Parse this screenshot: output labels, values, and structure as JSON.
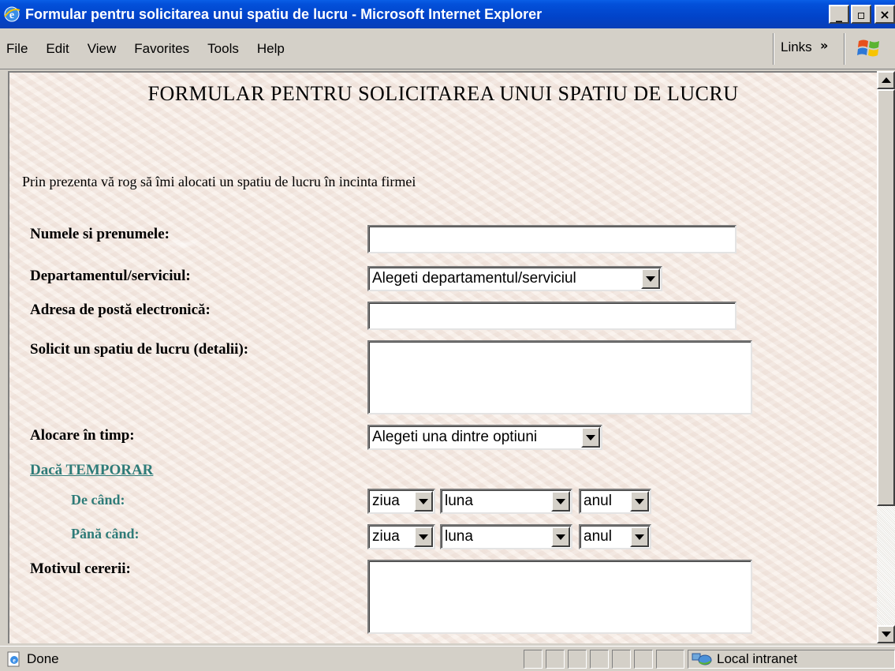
{
  "window": {
    "title": "Formular pentru solicitarea unui spatiu de lucru - Microsoft Internet Explorer",
    "minimize_label": "_",
    "maximize_label": "▫",
    "close_label": "×",
    "app_icon": "ie-icon"
  },
  "menubar": {
    "items": [
      "File",
      "Edit",
      "View",
      "Favorites",
      "Tools",
      "Help"
    ],
    "links_label": "Links",
    "links_chevron": "»",
    "logo_icon": "windows-flag-icon"
  },
  "form": {
    "title": "FORMULAR PENTRU SOLICITAREA UNUI SPATIU DE LUCRU",
    "intro": "Prin prezenta vă rog să îmi alocati un spatiu de lucru în incinta firmei",
    "name_label": "Numele si prenumele:",
    "name_value": "",
    "dept_label": "Departamentul/serviciul:",
    "dept_selected": "Alegeti departamentul/serviciul",
    "email_label": "Adresa de postă electronică:",
    "email_value": "",
    "details_label": "Solicit un spatiu de lucru (detalii):",
    "details_value": "",
    "alloc_label": "Alocare în timp:",
    "alloc_selected": "Alegeti una dintre optiuni",
    "temporary_link": "Dacă TEMPORAR",
    "from_label": "De când:",
    "to_label": "Până când:",
    "day_selected": "ziua",
    "month_selected": "luna",
    "year_selected": "anul",
    "reason_label": "Motivul cererii:",
    "reason_value": ""
  },
  "statusbar": {
    "status": "Done",
    "zone": "Local intranet",
    "status_icon": "ie-page-icon",
    "zone_icon": "local-intranet-icon"
  },
  "colors": {
    "titlebar": "#0143c9",
    "page_background": "#f7ede6",
    "section_accent": "#2e7b78"
  }
}
